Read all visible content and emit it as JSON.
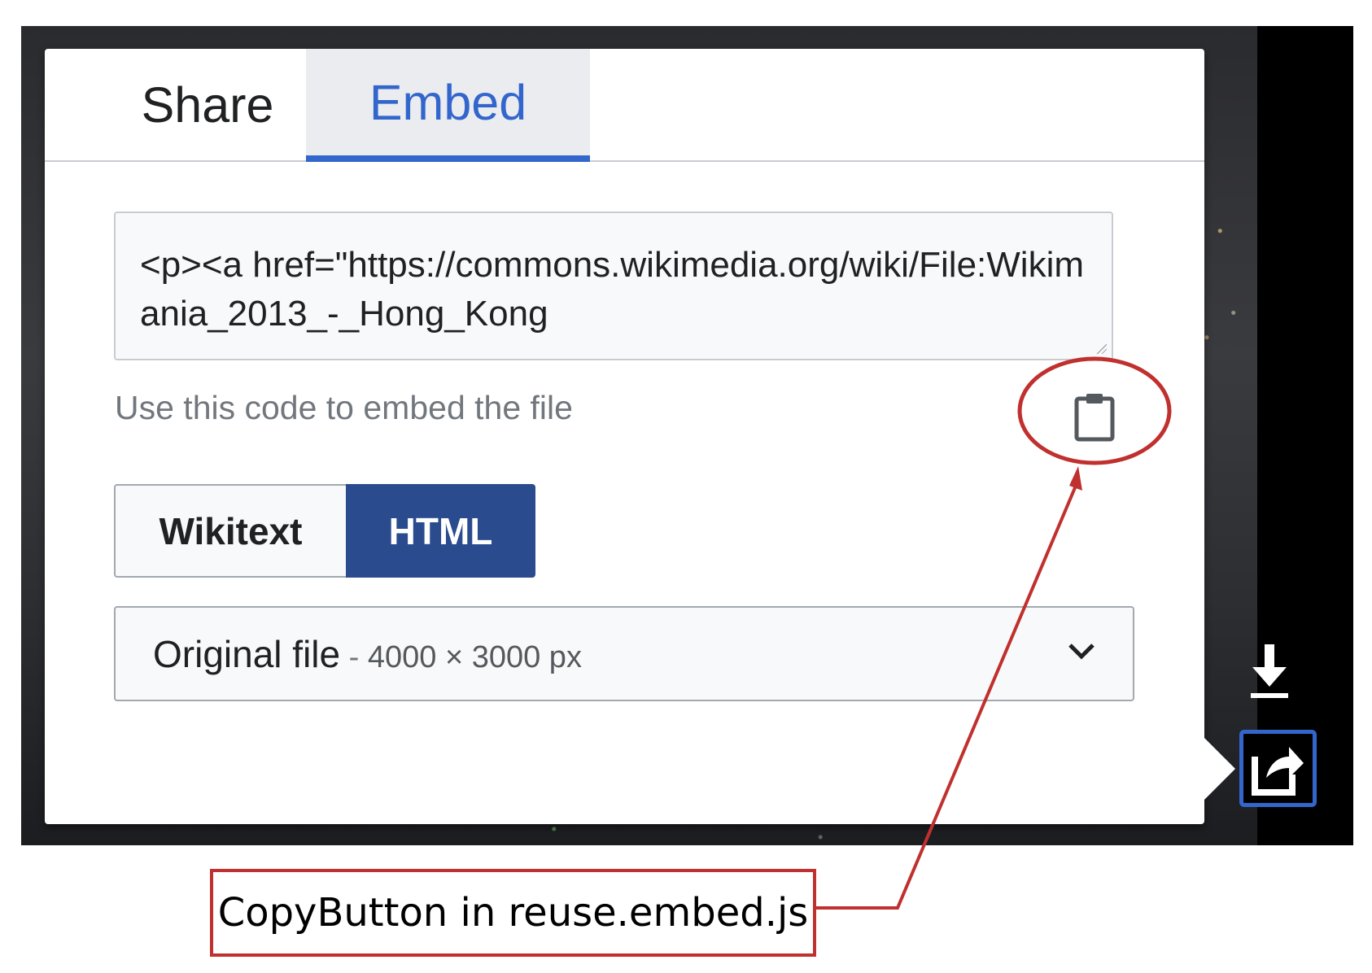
{
  "tabs": {
    "share_label": "Share",
    "embed_label": "Embed",
    "active": "Embed"
  },
  "embed": {
    "code_value": "<p><a href=\"https://commons.wikimedia.org/wiki/File:Wikimania_2013_-_Hong_Kong",
    "help_text": "Use this code to embed the file"
  },
  "format_toggle": {
    "wikitext_label": "Wikitext",
    "html_label": "HTML",
    "selected": "HTML"
  },
  "size_select": {
    "label": "Original file",
    "separator": " - ",
    "dimensions": "4000 × 3000 px"
  },
  "icons": {
    "copy": "clipboard-icon",
    "chevron": "chevron-down-icon",
    "download": "download-icon",
    "share": "share-icon"
  },
  "annotation": {
    "label": "CopyButton in reuse.embed.js",
    "color": "#c0302e"
  },
  "colors": {
    "accent": "#3366cc",
    "toggle_selected": "#2a4b8d",
    "annotation": "#c0302e"
  }
}
